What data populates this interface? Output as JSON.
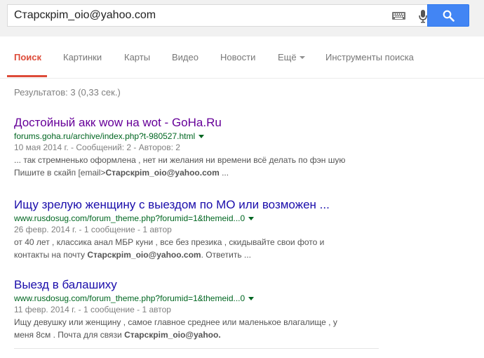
{
  "search": {
    "query": "Старскрim_oio@yahoo.com",
    "button_label": "Поиск"
  },
  "tabs": [
    {
      "label": "Поиск",
      "active": true
    },
    {
      "label": "Картинки",
      "active": false
    },
    {
      "label": "Карты",
      "active": false
    },
    {
      "label": "Видео",
      "active": false
    },
    {
      "label": "Новости",
      "active": false
    },
    {
      "label": "Ещё",
      "active": false,
      "has_dropdown": true
    },
    {
      "label": "Инструменты поиска",
      "active": false
    }
  ],
  "stats": "Результатов: 3 (0,33 сек.)",
  "results": [
    {
      "title": "Достойный акк wow на wot - GoHa.Ru",
      "visited": true,
      "url": "forums.goha.ru/archive/index.php?t-980527.html",
      "meta": "10 мая 2014 г. - Сообщений: 2 - Авторов: 2",
      "snippet_lines": [
        {
          "text": "... так стремненько оформлена , нет ни желания ни времени всё делать по фэн шую",
          "bold": "",
          "after": ""
        },
        {
          "text": "Пишите в скайп [email>",
          "bold": "Старскрim_oio@yahoo.com",
          "after": " ..."
        }
      ]
    },
    {
      "title": "Ищу зрелую женщину с выездом по МО или возможен ...",
      "visited": false,
      "url": "www.rusdosug.com/forum_theme.php?forumid=1&themeid...0",
      "meta": "26 февр. 2014 г. - 1 сообщение - 1 автор",
      "snippet_lines": [
        {
          "text": "от 40 лет , классика анал МБР куни , все без презика , скидывайте свои фото и",
          "bold": "",
          "after": ""
        },
        {
          "text": "контакты на почту ",
          "bold": "Старскрim_oio@yahoo.com",
          "after": ". Ответить ..."
        }
      ]
    },
    {
      "title": "Выезд в балашиху",
      "visited": false,
      "url": "www.rusdosug.com/forum_theme.php?forumid=1&themeid...0",
      "meta": "11 февр. 2014 г. - 1 сообщение - 1 автор",
      "snippet_lines": [
        {
          "text": "Ищу девушку или женщину , самое главное среднее или маленькое влагалище , у",
          "bold": "",
          "after": ""
        },
        {
          "text": "меня 8см . Почта для связи ",
          "bold": "Старскрim_oio@yahoo.",
          "after": ""
        }
      ]
    }
  ],
  "icons": {
    "keyboard": "keyboard-icon",
    "mic": "microphone-icon",
    "search": "magnifier-icon"
  },
  "colors": {
    "accent_red": "#dd4b39",
    "button_blue": "#4285f4",
    "link_blue": "#1a0dab",
    "link_visited": "#660099",
    "url_green": "#006621"
  }
}
